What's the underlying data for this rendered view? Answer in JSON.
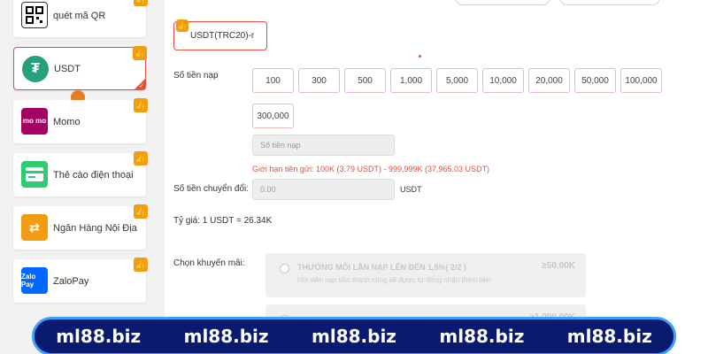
{
  "sidebar": {
    "items": [
      {
        "label": "quét mã QR",
        "icon": "qr-code-icon"
      },
      {
        "label": "USDT",
        "icon": "usdt-icon",
        "active": true
      },
      {
        "label": "Momo",
        "icon": "momo-icon",
        "icon_text": "mo mo"
      },
      {
        "label": "Thẻ cào điện thoại",
        "icon": "phone-card-icon"
      },
      {
        "label": "Ngân Hàng Nội Địa",
        "icon": "bank-transfer-icon"
      },
      {
        "label": "ZaloPay",
        "icon": "zalopay-icon",
        "icon_text": "Zalo Pay"
      }
    ]
  },
  "form": {
    "currency": "USDT(TRC20)-r",
    "amount_label": "Số tiền nạp",
    "amount_options": [
      "100",
      "300",
      "500",
      "1,000",
      "5,000",
      "10,000",
      "20,000",
      "50,000",
      "100,000",
      "300,000"
    ],
    "amount_placeholder": "Số tiền nạp",
    "limit_text": "Giới hạn tiền gửi:  100K (3.79 USDT) - 999,999K (37,965.03 USDT)",
    "converted_label": "Số tiền chuyển đổi:",
    "converted_value": "0.00",
    "converted_unit": "USDT",
    "rate_text": "Tỷ giá:  1  USDT  = 26.34K",
    "promo_label": "Chọn khuyến mãi:",
    "promos": [
      {
        "title": "THƯỞNG MỖI LẦN NẠP LÊN ĐẾN 1,5%( 2/2 )",
        "desc": "Hội viên nạp tiền thành công sẽ được tự động nhận thêm tiền",
        "amount": "≥50.00K"
      },
      {
        "title": "",
        "desc": "",
        "amount": "≥1,000.00K"
      }
    ]
  },
  "banner": {
    "items": [
      "ml88.biz",
      "ml88.biz",
      "ml88.biz",
      "ml88.biz",
      "ml88.biz"
    ]
  },
  "colors": {
    "accent": "#e74c3c",
    "badge": "#f39c12",
    "banner_bg": "#0a1a6e",
    "banner_border": "#3aa0ff"
  }
}
